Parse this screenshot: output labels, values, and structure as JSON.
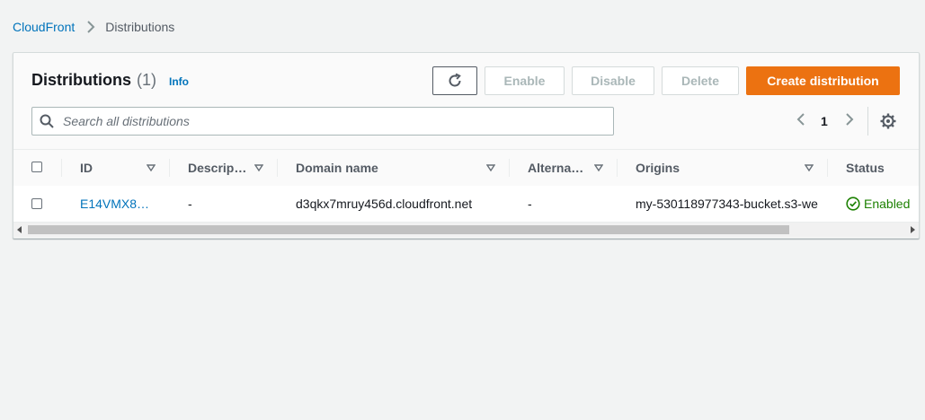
{
  "breadcrumb": {
    "root": "CloudFront",
    "current": "Distributions"
  },
  "panel": {
    "title": "Distributions",
    "count": "(1)",
    "info": "Info"
  },
  "toolbar": {
    "enable": "Enable",
    "disable": "Disable",
    "delete": "Delete",
    "create": "Create distribution"
  },
  "search": {
    "placeholder": "Search all distributions",
    "value": ""
  },
  "pagination": {
    "current_page": "1"
  },
  "table": {
    "columns": [
      "ID",
      "Descrip…",
      "Domain name",
      "Alterna…",
      "Origins",
      "Status"
    ],
    "rows": [
      {
        "id": "E14VMX8…",
        "description": "-",
        "domain": "d3qkx7mruy456d.cloudfront.net",
        "alternate": "-",
        "origins": "my-530118977343-bucket.s3-we",
        "status": "Enabled"
      }
    ]
  },
  "colors": {
    "link": "#0073bb",
    "primary": "#ec7211",
    "success": "#1d8102"
  }
}
